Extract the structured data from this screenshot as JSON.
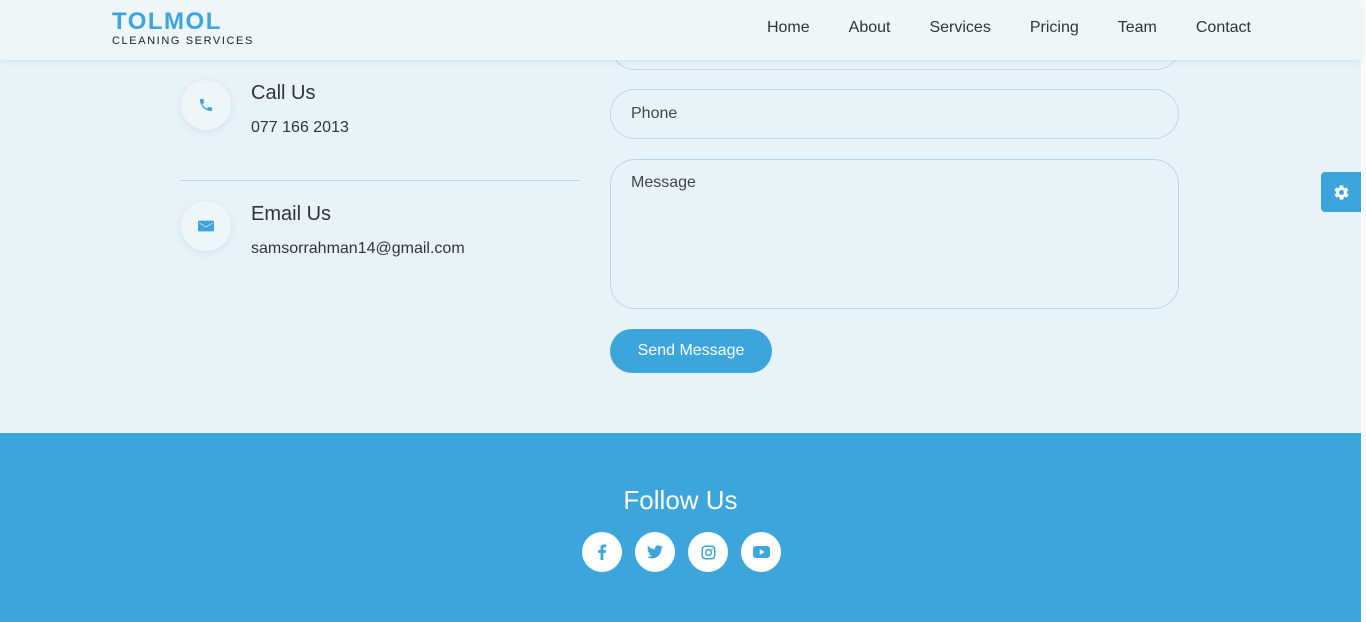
{
  "header": {
    "logo_title": "TOLMOL",
    "logo_subtitle": "CLEANING SERVICES",
    "nav": [
      "Home",
      "About",
      "Services",
      "Pricing",
      "Team",
      "Contact"
    ]
  },
  "contact_info": {
    "call": {
      "title": "Call Us",
      "value": "077 166 2013",
      "icon": "phone-icon"
    },
    "email": {
      "title": "Email Us",
      "value": "samsorrahman14@gmail.com",
      "icon": "envelope-icon"
    }
  },
  "form": {
    "phone_placeholder": "Phone",
    "message_placeholder": "Message",
    "send_label": "Send Message"
  },
  "footer": {
    "title": "Follow Us",
    "socials": [
      "facebook-icon",
      "twitter-icon",
      "instagram-icon",
      "youtube-icon"
    ]
  },
  "colors": {
    "accent": "#3ca6dc",
    "background": "#e8f3f9",
    "header_bg": "#eef6fa",
    "text": "#333333"
  }
}
